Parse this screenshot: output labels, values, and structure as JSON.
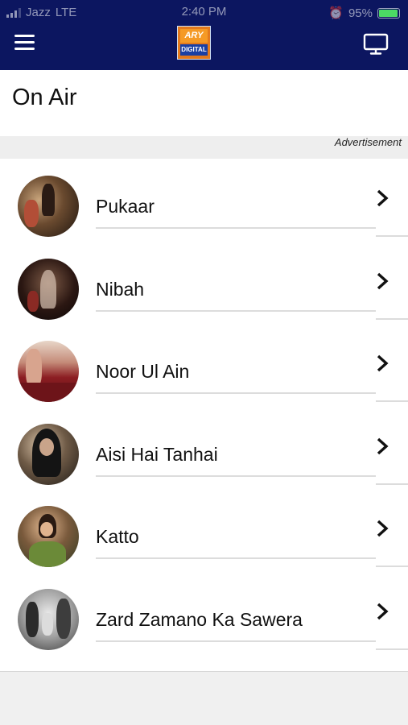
{
  "status_bar": {
    "carrier": "Jazz",
    "network": "LTE",
    "time": "2:40 PM",
    "battery": "95%",
    "battery_level": 0.95
  },
  "header": {
    "menu_icon": "hamburger-menu-icon",
    "logo": {
      "top": "ARY",
      "bottom": "DIGITAL"
    },
    "tv_icon": "tv-screen-icon"
  },
  "page": {
    "title": "On Air",
    "ad_label": "Advertisement"
  },
  "colors": {
    "header_bg": "#0c1660",
    "battery": "#4cd964",
    "logo_orange": "#e37a1d",
    "logo_blue": "#1a3fa3"
  },
  "shows": [
    {
      "title": "Pukaar"
    },
    {
      "title": "Nibah"
    },
    {
      "title": "Noor Ul Ain"
    },
    {
      "title": "Aisi Hai Tanhai"
    },
    {
      "title": "Katto"
    },
    {
      "title": "Zard Zamano Ka Sawera"
    }
  ]
}
